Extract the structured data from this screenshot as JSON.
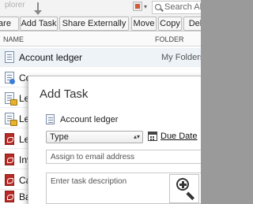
{
  "window": {
    "app_title": "plorer"
  },
  "search": {
    "text": "Search Al"
  },
  "toolbar": {
    "buttons": [
      "are",
      "Add Task",
      "Share Externally",
      "Move",
      "Copy",
      "Del"
    ]
  },
  "columns": {
    "name": "NAME",
    "folder": "FOLDER"
  },
  "files": [
    {
      "name": "Account ledger",
      "folder": "My Folders",
      "icon": "document-icon",
      "selected": true
    },
    {
      "name": "Co",
      "icon": "document-icon"
    },
    {
      "name": "Lea",
      "icon": "locked-document-icon"
    },
    {
      "name": "Lea",
      "icon": "locked-document-icon"
    },
    {
      "name": "Lea",
      "icon": "pdf-icon"
    },
    {
      "name": "Inv",
      "icon": "pdf-icon"
    },
    {
      "name": "Ca",
      "icon": "pdf-icon"
    },
    {
      "name": "Bal",
      "icon": "pdf-icon"
    }
  ],
  "modal": {
    "title": "Add Task",
    "file_name": "Account ledger",
    "type_label": "Type",
    "due_date_label": "Due Date",
    "email_placeholder": "Assign to email address",
    "description_placeholder": "Enter task description"
  },
  "icons": {
    "zoom": "zoom-in-icon",
    "calendar": "calendar-icon",
    "annotation": "arrow-down-icon"
  }
}
